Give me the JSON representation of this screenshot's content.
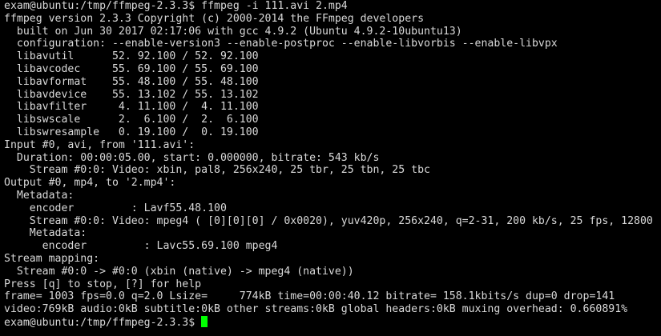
{
  "terminal": {
    "lines": [
      "exam@ubuntu:/tmp/ffmpeg-2.3.3$ ffmpeg -i 111.avi 2.mp4",
      "ffmpeg version 2.3.3 Copyright (c) 2000-2014 the FFmpeg developers",
      "  built on Jun 30 2017 02:17:06 with gcc 4.9.2 (Ubuntu 4.9.2-10ubuntu13)",
      "  configuration: --enable-version3 --enable-postproc --enable-libvorbis --enable-libvpx",
      "  libavutil      52. 92.100 / 52. 92.100",
      "  libavcodec     55. 69.100 / 55. 69.100",
      "  libavformat    55. 48.100 / 55. 48.100",
      "  libavdevice    55. 13.102 / 55. 13.102",
      "  libavfilter     4. 11.100 /  4. 11.100",
      "  libswscale      2.  6.100 /  2.  6.100",
      "  libswresample   0. 19.100 /  0. 19.100",
      "Input #0, avi, from '111.avi':",
      "  Duration: 00:00:05.00, start: 0.000000, bitrate: 543 kb/s",
      "    Stream #0:0: Video: xbin, pal8, 256x240, 25 tbr, 25 tbn, 25 tbc",
      "Output #0, mp4, to '2.mp4':",
      "  Metadata:",
      "    encoder         : Lavf55.48.100",
      "    Stream #0:0: Video: mpeg4 ( [0][0][0] / 0x0020), yuv420p, 256x240, q=2-31, 200 kb/s, 25 fps, 12800",
      "    Metadata:",
      "      encoder         : Lavc55.69.100 mpeg4",
      "Stream mapping:",
      "  Stream #0:0 -> #0:0 (xbin (native) -> mpeg4 (native))",
      "Press [q] to stop, [?] for help",
      "frame= 1003 fps=0.0 q=2.0 Lsize=     774kB time=00:00:40.12 bitrate= 158.1kbits/s dup=0 drop=141",
      "video:769kB audio:0kB subtitle:0kB other streams:0kB global headers:0kB muxing overhead: 0.660891%"
    ],
    "final_prompt": "exam@ubuntu:/tmp/ffmpeg-2.3.3$ ",
    "cursor_color": "#00ff00",
    "text_color": "#d9d9d9",
    "background_color": "#000000"
  }
}
